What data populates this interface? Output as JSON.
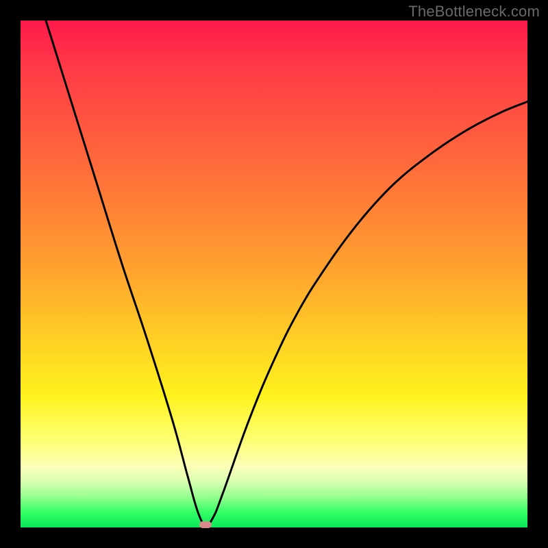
{
  "watermark": "TheBottleneck.com",
  "chart_data": {
    "type": "line",
    "title": "",
    "xlabel": "",
    "ylabel": "",
    "xlim": [
      0,
      100
    ],
    "ylim": [
      0,
      100
    ],
    "grid": false,
    "legend": false,
    "series": [
      {
        "name": "curve",
        "x": [
          5,
          10,
          15,
          20,
          25,
          30,
          33,
          35,
          36.5,
          38,
          40,
          45,
          50,
          55,
          60,
          65,
          70,
          75,
          80,
          85,
          90,
          95,
          100
        ],
        "y": [
          100,
          84,
          68,
          52,
          37,
          21,
          10,
          3,
          0.5,
          2,
          7,
          21,
          33,
          43,
          51,
          58,
          64,
          69,
          73,
          76.5,
          79.5,
          82,
          84
        ]
      }
    ],
    "marker": {
      "x": 36.5,
      "y": 0.5
    },
    "gradient_stops": [
      {
        "pos": 0,
        "color": "#ff1a4b"
      },
      {
        "pos": 50,
        "color": "#ffa52e"
      },
      {
        "pos": 74,
        "color": "#fff21e"
      },
      {
        "pos": 100,
        "color": "#07e85a"
      }
    ]
  }
}
